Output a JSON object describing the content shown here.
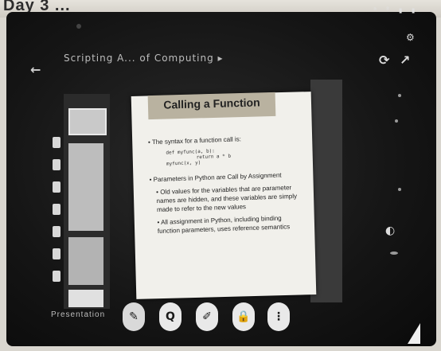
{
  "page": {
    "heading": "Day 3 ..."
  },
  "status_bar": {
    "text": "ᵃ ⁸ ▮ ▮"
  },
  "topbar": {
    "title": "Scripting A... of Computing ▸"
  },
  "slide": {
    "title": "Calling a Function",
    "bullets": [
      {
        "text": "• The syntax for a function call is:",
        "code": [
          "def myfunc(a, b):",
          "return a * b",
          "myfunc(x, y)"
        ]
      },
      {
        "text": "• Parameters in Python are Call by Assignment"
      },
      {
        "text": "• Old values for the variables that are parameter names are hidden, and these variables are simply made to refer to the new values"
      },
      {
        "text": "• All assignment in Python, including binding function parameters, uses reference semantics"
      }
    ]
  },
  "bottom_bar": {
    "buttons": [
      {
        "name": "pen-button",
        "icon": "pen-icon",
        "glyph": "✎"
      },
      {
        "name": "search-button",
        "icon": "search-icon",
        "glyph": "Q"
      },
      {
        "name": "highlighter-button",
        "icon": "highlighter-icon",
        "glyph": "✐"
      },
      {
        "name": "lock-button",
        "icon": "lock-icon",
        "glyph": "🔒"
      },
      {
        "name": "more-button",
        "icon": "more-icon",
        "glyph": "⋮"
      }
    ],
    "left_text": "Presentation"
  },
  "colors": {
    "screen_bg": "#151515",
    "slide_bg": "#f1f0eb",
    "header_band": "#b9b2a0"
  }
}
